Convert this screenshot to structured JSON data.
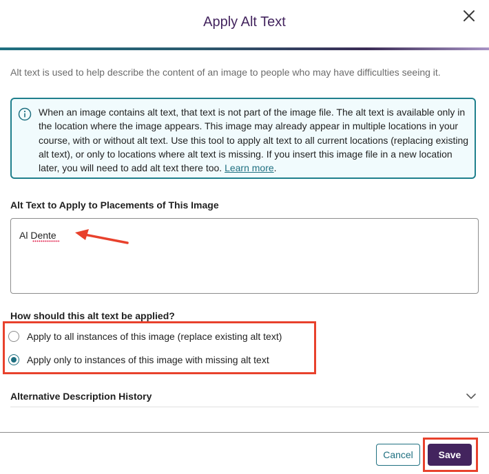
{
  "dialog": {
    "title": "Apply Alt Text"
  },
  "intro": "Alt text is used to help describe the content of an image to people who may have difficulties seeing it.",
  "info": {
    "text": "When an image contains alt text, that text is not part of the image file. The alt text is available only in the location where the image appears. This image may already appear in multiple locations in your course, with or without alt text. Use this tool to apply alt text to all current locations (replacing existing alt text), or only to locations where alt text is missing. If you insert this image file in a new location later, you will need to add alt text there too. ",
    "link_label": "Learn more",
    "suffix": "."
  },
  "alt_text": {
    "label": "Alt Text to Apply to Placements of This Image",
    "value": "Al Dente"
  },
  "apply_mode": {
    "question": "How should this alt text be applied?",
    "options": [
      {
        "label": "Apply to all instances of this image (replace existing alt text)",
        "selected": false
      },
      {
        "label": "Apply only to instances of this image with missing alt text",
        "selected": true
      }
    ]
  },
  "history": {
    "label": "Alternative Description History"
  },
  "footer": {
    "cancel_label": "Cancel",
    "save_label": "Save"
  },
  "colors": {
    "title": "#43245e",
    "accent": "#1e6f80",
    "primary_button": "#43245e",
    "annotation": "#e8412c",
    "info_background": "#f1fbfd"
  },
  "icons": {
    "close": "close-icon",
    "info": "info-icon",
    "chevron": "chevron-down-icon"
  }
}
